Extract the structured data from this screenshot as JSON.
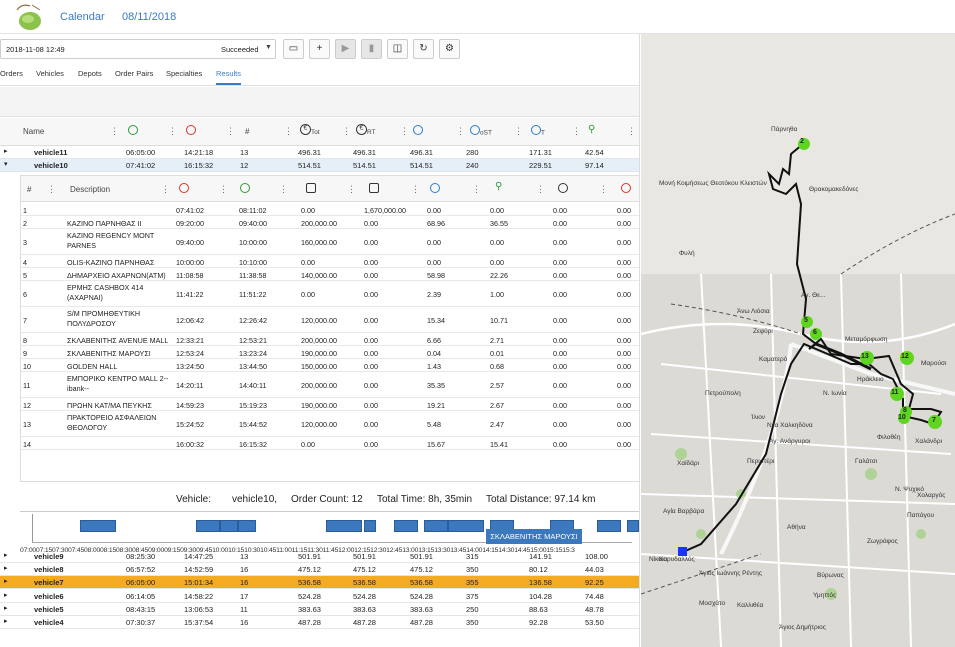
{
  "app": {
    "nav": [
      "Calendar",
      "08/11/2018"
    ]
  },
  "toolbar": {
    "run_date": "2018-11-08 12:49",
    "run_status": "Succeeded",
    "buttons": [
      "comment-icon",
      "plus-icon",
      "play-icon",
      "trash-icon",
      "layers-icon",
      "refresh-icon",
      "settings-icon"
    ]
  },
  "tabs": [
    "Orders",
    "Vehicles",
    "Depots",
    "Order Pairs",
    "Specialties",
    "Results"
  ],
  "active_tab": "Results",
  "main_table": {
    "name_header": "Name",
    "hash_header": "#",
    "header_icons": [
      "start-time-icon",
      "end-time-icon",
      "tot-cost-icon",
      "rt-cost-icon",
      "duration-icon",
      "ost-duration-icon",
      "t-duration-icon",
      "distance-icon"
    ],
    "tot_sub": "Tot",
    "rt_sub": "RT",
    "ost_sub": "oST",
    "t_sub": "T",
    "rows_top": [
      {
        "name": "vehicle11",
        "start": "06:05:00",
        "end": "14:21:18",
        "count": "13",
        "tot": "496.31",
        "rt": "496.31",
        "d1": "496.31",
        "d2": "280",
        "d3": "171.31",
        "dist": "42.54"
      },
      {
        "name": "vehicle10",
        "start": "07:41:02",
        "end": "16:15:32",
        "count": "12",
        "tot": "514.51",
        "rt": "514.51",
        "d1": "514.51",
        "d2": "240",
        "d3": "229.51",
        "dist": "97.14"
      }
    ],
    "rows_bottom": [
      {
        "name": "vehicle9",
        "start": "08:25:30",
        "end": "14:47:25",
        "count": "13",
        "tot": "501.91",
        "rt": "501.91",
        "d1": "501.91",
        "d2": "315",
        "d3": "141.91",
        "dist": "108.00"
      },
      {
        "name": "vehicle8",
        "start": "06:57:52",
        "end": "14:52:59",
        "count": "16",
        "tot": "475.12",
        "rt": "475.12",
        "d1": "475.12",
        "d2": "350",
        "d3": "80.12",
        "dist": "44.03"
      },
      {
        "name": "vehicle7",
        "start": "06:05:00",
        "end": "15:01:34",
        "count": "16",
        "tot": "536.58",
        "rt": "536.58",
        "d1": "536.58",
        "d2": "355",
        "d3": "136.58",
        "dist": "92.25"
      },
      {
        "name": "vehicle6",
        "start": "06:14:05",
        "end": "14:58:22",
        "count": "17",
        "tot": "524.28",
        "rt": "524.28",
        "d1": "524.28",
        "d2": "375",
        "d3": "104.28",
        "dist": "74.48"
      },
      {
        "name": "vehicle5",
        "start": "08:43:15",
        "end": "13:06:53",
        "count": "11",
        "tot": "383.63",
        "rt": "383.63",
        "d1": "383.63",
        "d2": "250",
        "d3": "88.63",
        "dist": "48.78"
      },
      {
        "name": "vehicle4",
        "start": "07:30:37",
        "end": "15:37:54",
        "count": "16",
        "tot": "487.28",
        "rt": "487.28",
        "d1": "487.28",
        "d2": "350",
        "d3": "92.28",
        "dist": "53.50"
      }
    ]
  },
  "detail": {
    "headers": {
      "num": "#",
      "desc": "Description"
    },
    "rows": [
      {
        "n": "1",
        "desc": "",
        "arr": "07:41:02",
        "dep": "08:11:02",
        "a": "0.00",
        "b": "1,670,000.00",
        "c": "0.00",
        "d": "0.00",
        "e": "0.00",
        "f": "0.00"
      },
      {
        "n": "2",
        "desc": "ΚΑΖΙΝΟ ΠΑΡΝΗΘΑΣ II",
        "arr": "09:20:00",
        "dep": "09:40:00",
        "a": "200,000.00",
        "b": "0.00",
        "c": "68.96",
        "d": "36.55",
        "e": "0.00",
        "f": "0.00"
      },
      {
        "n": "3",
        "desc": "ΚΑΖΙΝΟ REGENCY MONT PARNES",
        "arr": "09:40:00",
        "dep": "10:00:00",
        "a": "160,000.00",
        "b": "0.00",
        "c": "0.00",
        "d": "0.00",
        "e": "0.00",
        "f": "0.00"
      },
      {
        "n": "4",
        "desc": "OLIS-ΚΑΖΙΝΟ ΠΑΡΝΗΘΑΣ",
        "arr": "10:00:00",
        "dep": "10:10:00",
        "a": "0.00",
        "b": "0.00",
        "c": "0.00",
        "d": "0.00",
        "e": "0.00",
        "f": "0.00"
      },
      {
        "n": "5",
        "desc": "ΔΗΜΑΡΧΕΙΟ ΑΧΑΡΝΩΝ(ATM)",
        "arr": "11:08:58",
        "dep": "11:38:58",
        "a": "140,000.00",
        "b": "0.00",
        "c": "58.98",
        "d": "22.26",
        "e": "0.00",
        "f": "0.00"
      },
      {
        "n": "6",
        "desc": "ΕΡΜΗΣ CASHBOX 414 (ΑΧΑΡΝΑΙ)",
        "arr": "11:41:22",
        "dep": "11:51:22",
        "a": "0.00",
        "b": "0.00",
        "c": "2.39",
        "d": "1.00",
        "e": "0.00",
        "f": "0.00"
      },
      {
        "n": "7",
        "desc": "S/M ΠΡΟΜΗΘΕΥΤΙΚΗ ΠΟΛΥΔΡΟΣΟΥ",
        "arr": "12:06:42",
        "dep": "12:26:42",
        "a": "120,000.00",
        "b": "0.00",
        "c": "15.34",
        "d": "10.71",
        "e": "0.00",
        "f": "0.00"
      },
      {
        "n": "8",
        "desc": "ΣΚΛΑΒΕΝΙΤΗΣ AVENUE MALL",
        "arr": "12:33:21",
        "dep": "12:53:21",
        "a": "200,000.00",
        "b": "0.00",
        "c": "6.66",
        "d": "2.71",
        "e": "0.00",
        "f": "0.00"
      },
      {
        "n": "9",
        "desc": "ΣΚΛΑΒΕΝΙΤΗΣ ΜΑΡΟΥΣΙ",
        "arr": "12:53:24",
        "dep": "13:23:24",
        "a": "190,000.00",
        "b": "0.00",
        "c": "0.04",
        "d": "0.01",
        "e": "0.00",
        "f": "0.00"
      },
      {
        "n": "10",
        "desc": "GOLDEN HALL",
        "arr": "13:24:50",
        "dep": "13:44:50",
        "a": "150,000.00",
        "b": "0.00",
        "c": "1.43",
        "d": "0.68",
        "e": "0.00",
        "f": "0.00"
      },
      {
        "n": "11",
        "desc": "ΕΜΠΟΡΙΚΟ ΚΕΝΤΡΟ MALL 2--ibank--",
        "arr": "14:20:11",
        "dep": "14:40:11",
        "a": "200,000.00",
        "b": "0.00",
        "c": "35.35",
        "d": "2.57",
        "e": "0.00",
        "f": "0.00"
      },
      {
        "n": "12",
        "desc": "ΠΡΩΗΝ ΚΑΤ/ΜΑ ΠΕΥΚΗΣ",
        "arr": "14:59:23",
        "dep": "15:19:23",
        "a": "190,000.00",
        "b": "0.00",
        "c": "19.21",
        "d": "2.67",
        "e": "0.00",
        "f": "0.00"
      },
      {
        "n": "13",
        "desc": "ΠΡΑΚΤΟΡΕΙΟ ΑΣΦΑΛΕΙΩΝ ΘΕΟΛΟΓΟΥ",
        "arr": "15:24:52",
        "dep": "15:44:52",
        "a": "120,000.00",
        "b": "0.00",
        "c": "5.48",
        "d": "2.47",
        "e": "0.00",
        "f": "0.00"
      },
      {
        "n": "14",
        "desc": "",
        "arr": "16:00:32",
        "dep": "16:15:32",
        "a": "0.00",
        "b": "0.00",
        "c": "15.67",
        "d": "15.41",
        "e": "0.00",
        "f": "0.00"
      }
    ]
  },
  "summary": {
    "vehicle_label": "Vehicle:",
    "vehicle_value": "vehicle10,",
    "order_count": "Order Count: 12",
    "total_time": "Total Time: 8h, 35min",
    "total_distance": "Total Distance: 97.14 km"
  },
  "timeline": {
    "tooltip": "ΣΚΛΑΒΕΝΙΤΗΣ ΜΑΡΟΥΣΙ",
    "ticks": "07:0007:1507:3007:4508:0008:1508:3008:4509:0009:1509:3009:4510:0010:1510:3010:4511:0011:1511:3011:4512:0012:1512:3012:4513:0013:1513:3013:4514:0014:1514:3014:4515:0015:1515:3"
  },
  "map": {
    "labels": [
      "Πάρνηθα",
      "Μονή Κοιμήσεως Θεοτόκου Κλειστών",
      "Θρακομακεδόνες",
      "Φυλή",
      "Αγ. Θε...",
      "Άνω Λιόσια",
      "Ζεφύρι",
      "Μεταμόρφωση",
      "Καματερό",
      "Ηράκλειο",
      "Μαρούσι",
      "Πετρούπολη",
      "Ν. Ιωνία",
      "Ίλιον",
      "Φιλοθέη",
      "Χαλάνδρι",
      "Νέα Χαλκηδόνα",
      "Αγ. Ανάργυροι",
      "Χαϊδάρι",
      "Περιστέρι",
      "Γαλάτσι",
      "Ν. Ψυχικό",
      "Χολαργός",
      "Παπάγου",
      "Αγία Βαρβάρα",
      "Αθήνα",
      "Ζωγράφος",
      "Κορυδαλλός",
      "Νίκαια",
      "Άγιος Ιωάννης Ρέντης",
      "Βύρωνας",
      "Μοσχάτο",
      "Καλλιθέα",
      "Υμηττός",
      "Άγιος Δημήτριος"
    ],
    "markers": [
      "5",
      "6",
      "13",
      "12",
      "11",
      "8",
      "10",
      "7",
      "2"
    ]
  }
}
